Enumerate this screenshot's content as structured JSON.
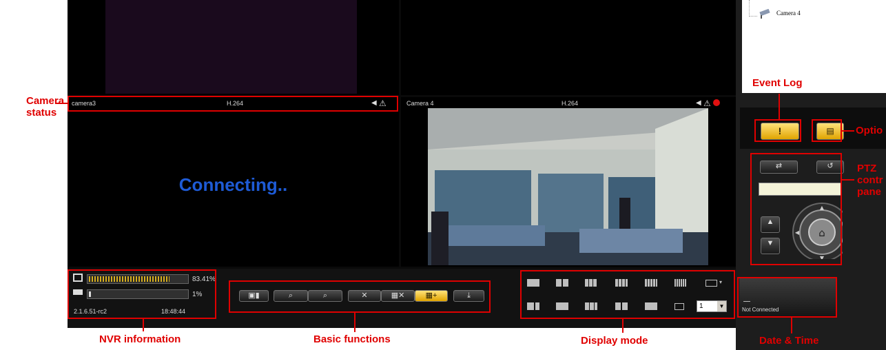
{
  "tree": {
    "camera4_label": "Camera 4"
  },
  "tiles": {
    "camera3": {
      "name": "camera3",
      "codec": "H.264",
      "status": "Connecting.."
    },
    "camera4": {
      "name": "Camera 4",
      "codec": "H.264"
    }
  },
  "nvr": {
    "cpu_percent": "83.41%",
    "mem_percent": "1%",
    "version": "2.1.6.51-rc2",
    "time": "18:48:44"
  },
  "date_time": {
    "status": "Not Connected"
  },
  "display": {
    "channel_value": "1"
  },
  "annotations": {
    "camera_status": "Camera\nstatus",
    "event_log": "Event Log",
    "options": "Optio",
    "ptz": "PTZ\ncontr\npane",
    "nvr_info": "NVR information",
    "basic_functions": "Basic functions",
    "display_mode": "Display mode",
    "date_time": "Date & Time"
  },
  "colors": {
    "accent_red": "#e00000",
    "connecting_blue": "#1e5bd6",
    "button_yellow": "#f0b800"
  }
}
